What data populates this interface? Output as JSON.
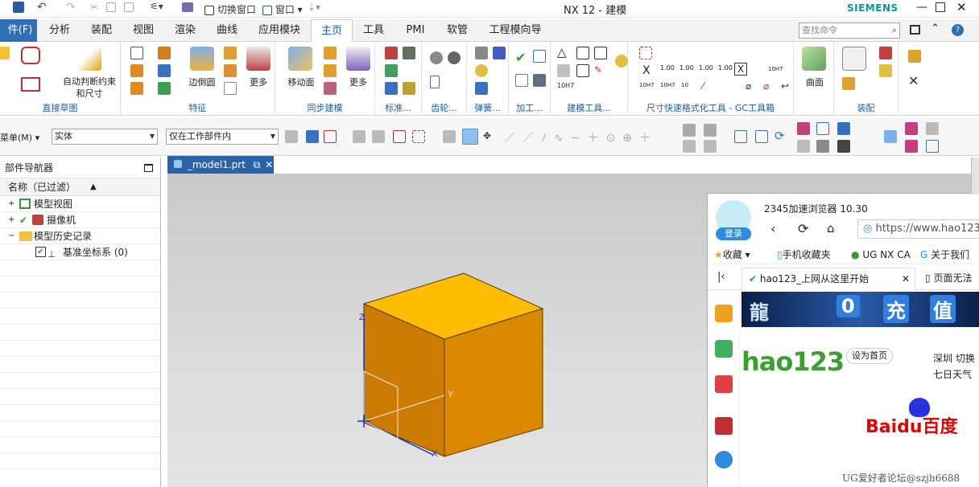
{
  "titlebar": {
    "title": "NX 12 - 建模",
    "brand": "SIEMENS",
    "switch_window": "切换窗口",
    "window_menu": "窗口"
  },
  "menu": {
    "file": "件(F)",
    "tabs": [
      "分析",
      "装配",
      "视图",
      "渲染",
      "曲线",
      "应用模块",
      "主页",
      "工具",
      "PMI",
      "软管",
      "工程模向导"
    ],
    "active": "主页",
    "search_placeholder": "查找命令"
  },
  "ribbon": {
    "auto_constraint": "自动判断约束和尺寸",
    "direct_sketch": "直接草图",
    "edge_blend": "边倒圆",
    "more": "更多",
    "feature": "特征",
    "move_face": "移动面",
    "sync_modeling": "同步建模",
    "standard": "标准...",
    "gear": "齿轮...",
    "spring": "弹簧...",
    "machining": "加工...",
    "modeling_tools": "建模工具...",
    "dim_tool": "尺寸快速格式化工具 - GC工具箱",
    "surface": "曲面",
    "assembly": "装配",
    "dim_values": [
      "1.00",
      "1.00",
      "1.00",
      "1.00",
      "10H7",
      "10H7",
      "10H7",
      "10"
    ]
  },
  "toolbar2": {
    "menu": "菜单(M)",
    "filter": "实体",
    "scope": "仅在工作部件内"
  },
  "navigator": {
    "title": "部件导航器",
    "column": "名称（已过滤）",
    "items": [
      {
        "label": "模型视图"
      },
      {
        "label": "摄像机"
      },
      {
        "label": "模型历史记录"
      },
      {
        "label": "基准坐标系 (0)"
      }
    ]
  },
  "viewport": {
    "tab": "_model1.prt",
    "axis_x": "X",
    "axis_y": "Y",
    "axis_z": "Z"
  },
  "browser": {
    "title": "2345加速浏览器 10.30",
    "login": "登录",
    "url": "https://www.hao123",
    "bookmarks": [
      "收藏",
      "手机收藏夹",
      "UG NX CA",
      "关于我们"
    ],
    "tab1": "hao123_上网从这里开始",
    "tab2": "页面无法",
    "banner": [
      "龍",
      "0",
      "充",
      "值"
    ],
    "hao123": "hao123",
    "set_home": "设为首页",
    "city": "深圳 切换",
    "weather": "七日天气",
    "baidu": "Baidu百度"
  },
  "watermark": "UG爱好者论坛@szjh6688",
  "colors": {
    "cube_front": "#c97a00",
    "cube_top": "#ffbd00",
    "cube_side": "#d88800",
    "accent": "#2f6fb6",
    "brand": "#009999"
  }
}
